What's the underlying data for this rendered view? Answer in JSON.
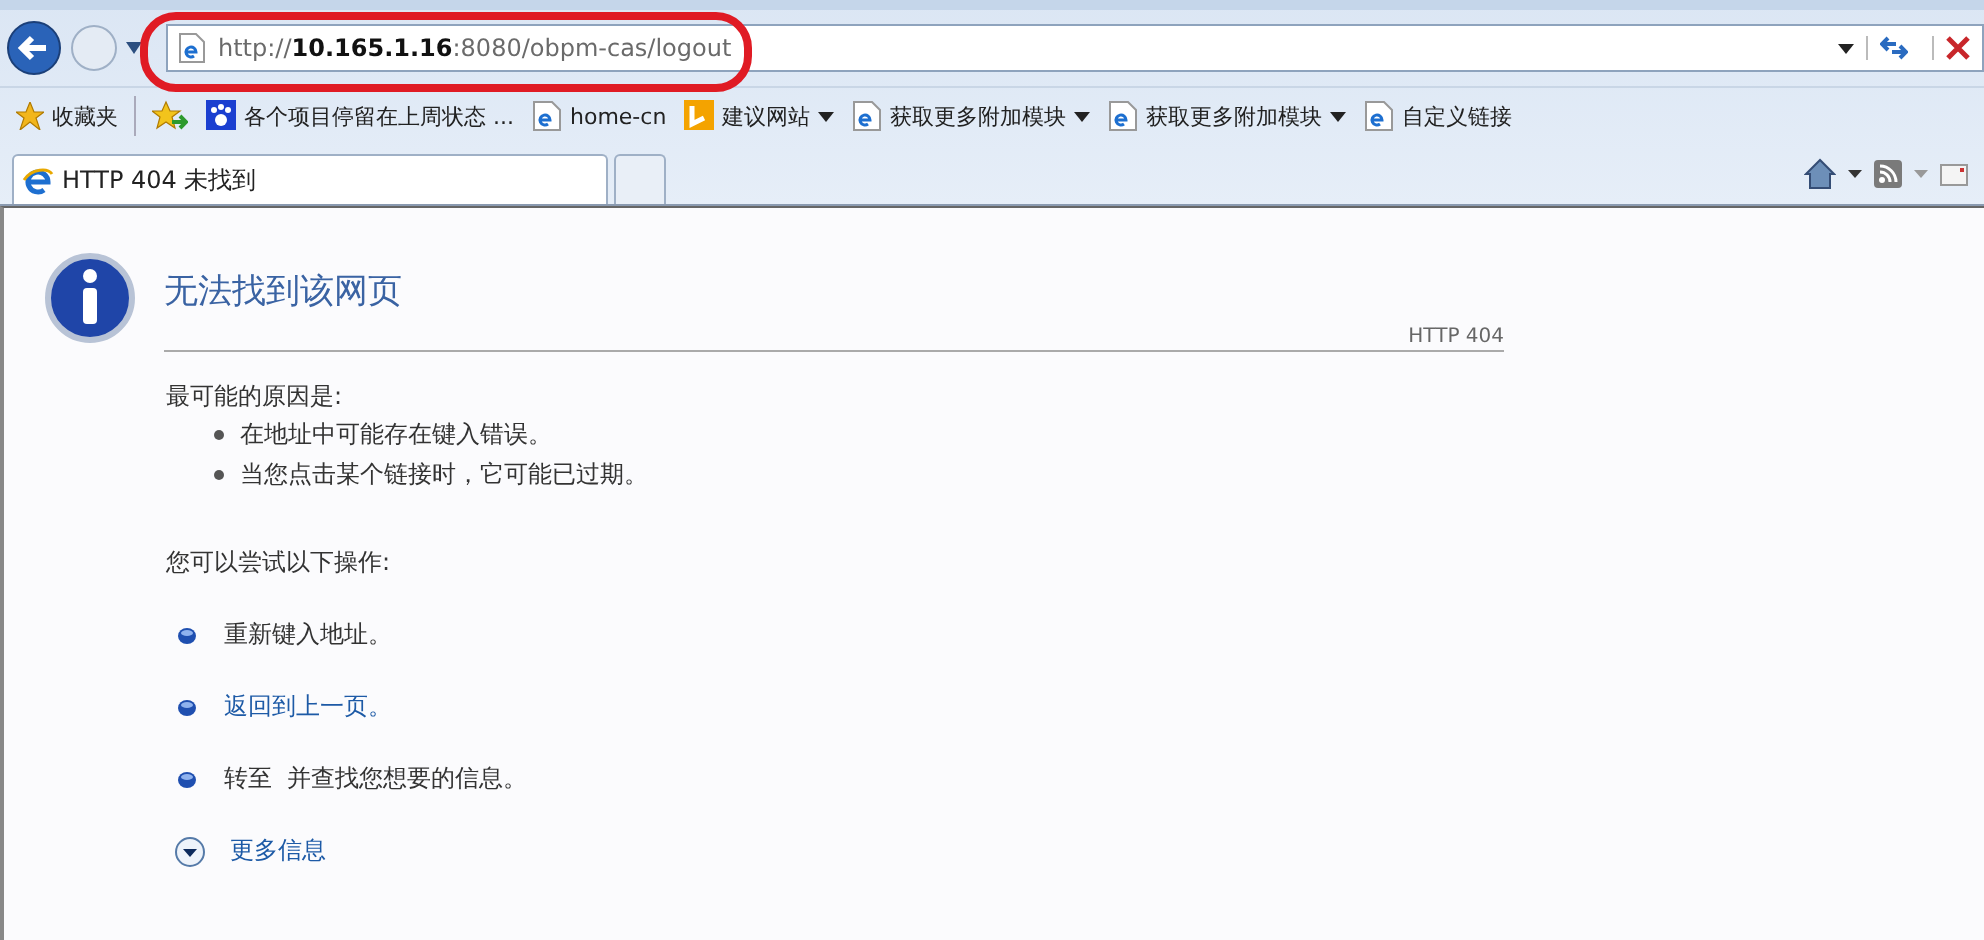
{
  "address_bar": {
    "url": "http://**10.165.1.16**:8080/obpm-cas/logout",
    "annotated": true
  },
  "favorites_bar": {
    "favorites_label": "收藏夹",
    "links": [
      {
        "label": "各个项目停留在上周状态 ...",
        "kind": "paw",
        "dropdown": false
      },
      {
        "label": "home-cn",
        "kind": "ie",
        "dropdown": false
      },
      {
        "label": "建议网站",
        "kind": "bing",
        "dropdown": true
      },
      {
        "label": "获取更多附加模块",
        "kind": "ie",
        "dropdown": true
      },
      {
        "label": "获取更多附加模块",
        "kind": "ie",
        "dropdown": true
      },
      {
        "label": "自定义链接",
        "kind": "ie",
        "dropdown": false
      }
    ]
  },
  "tabs": [
    {
      "label": "HTTP 404 未找到",
      "selected": true
    },
    {
      "selected": false
    }
  ],
  "page": {
    "title": "无法找到该网页",
    "code": "HTTP 404",
    "causes_heading": "最可能的原因是:",
    "causes": [
      "在地址中可能存在键入错误。",
      "当您点击某个链接时，它可能已过期。"
    ],
    "actions_heading": "您可以尝试以下操作:",
    "actions": [
      {
        "text": "重新键入地址。",
        "link": false
      },
      {
        "text": "返回到上一页。",
        "link": true
      },
      {
        "text": "转至  并查找您想要的信息。",
        "link": false
      }
    ],
    "more_info": "更多信息"
  }
}
